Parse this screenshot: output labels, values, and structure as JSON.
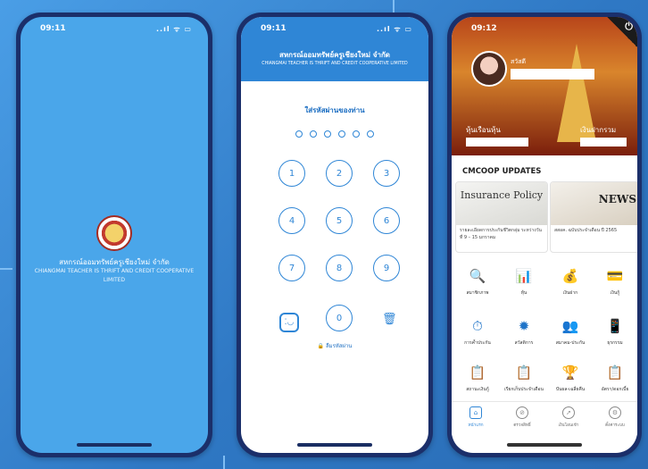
{
  "splash": {
    "time": "09:11",
    "status_icons": "..ıl ᯤ ▭",
    "org_name_th": "สหกรณ์ออมทรัพย์ครูเชียงใหม่ จำกัด",
    "org_name_en": "CHIANGMAI TEACHER IS THRIFT AND CREDIT COOPERATIVE LIMITED"
  },
  "pin": {
    "time": "09:11",
    "status_icons": "..ıl ᯤ ▭",
    "header_th": "สหกรณ์ออมทรัพย์ครูเชียงใหม่ จำกัด",
    "header_en": "CHIANGMAI TEACHER IS THRIFT AND CREDIT COOPERATIVE LIMITED",
    "title": "ใส่รหัสผ่านของท่าน",
    "keys": [
      "1",
      "2",
      "3",
      "4",
      "5",
      "6",
      "7",
      "8",
      "9",
      "0"
    ],
    "faceid_icon": "faceid-icon",
    "delete_icon": "trash-icon",
    "forgot_label": "ลืมรหัสผ่าน"
  },
  "home": {
    "time": "09:12",
    "greeting": "สวัสดี",
    "share_label": "หุ้นเรือนหุ้น",
    "deposit_label": "เงินฝากรวม",
    "updates_title": "CMCOOP UPDATES",
    "news": [
      {
        "image_text": "Insurance Policy",
        "caption": "รายละเอียดการประกันชีวิตกลุ่ม ระหว่างวันที่ 9 – 15 มกราคม"
      },
      {
        "image_text": "NEWS",
        "caption": "สสอค. ฉบับประจำเดือน ปี 2565"
      }
    ],
    "menu": [
      {
        "label": "สมาชิกภาพ",
        "icon": "search-icon",
        "glyph": "🔍"
      },
      {
        "label": "หุ้น",
        "icon": "chart-icon",
        "glyph": "📊"
      },
      {
        "label": "เงินฝาก",
        "icon": "money-bag-icon",
        "glyph": "💰"
      },
      {
        "label": "เงินกู้",
        "icon": "loan-icon",
        "glyph": "💳"
      },
      {
        "label": "การค้ำประกัน",
        "icon": "guarantee-icon",
        "glyph": "⏱"
      },
      {
        "label": "สวัสดิการ",
        "icon": "welfare-icon",
        "glyph": "✹"
      },
      {
        "label": "สมาคม-ประกัน",
        "icon": "insurance-icon",
        "glyph": "👥"
      },
      {
        "label": "ธุรกรรม",
        "icon": "transaction-icon",
        "glyph": "📱"
      },
      {
        "label": "สถานะเงินกู้",
        "icon": "loan-status-icon",
        "glyph": "📋"
      },
      {
        "label": "เรียกเก็บประจำเดือน",
        "icon": "billing-icon",
        "glyph": "📋"
      },
      {
        "label": "ปันผล-เฉลี่ยคืน",
        "icon": "dividend-icon",
        "glyph": "🏆"
      },
      {
        "label": "อัตรา/ดอกเบี้ย",
        "icon": "rate-icon",
        "glyph": "📋"
      }
    ],
    "tabs": [
      {
        "label": "หน้าแรก",
        "icon": "home-icon",
        "glyph": "⌂"
      },
      {
        "label": "ตรวจสิทธิ์",
        "icon": "compass-icon",
        "glyph": "⊘"
      },
      {
        "label": "เงินโอนเข้า",
        "icon": "transfer-icon",
        "glyph": "➚"
      },
      {
        "label": "ตั้งค่าระบบ",
        "icon": "settings-icon",
        "glyph": "⚙"
      }
    ]
  }
}
